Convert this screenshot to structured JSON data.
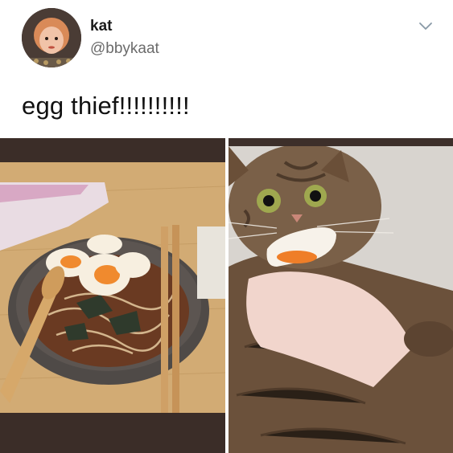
{
  "tweet": {
    "display_name": "kat",
    "handle": "@bbykaat",
    "text": "egg thief!!!!!!!!!!"
  },
  "icons": {
    "menu": "chevron-down-icon",
    "avatar": "avatar-photo"
  },
  "media": {
    "count": 2
  },
  "colors": {
    "text": "#111111",
    "secondary_text": "#6b6b6b",
    "chevron": "#8899a6"
  }
}
